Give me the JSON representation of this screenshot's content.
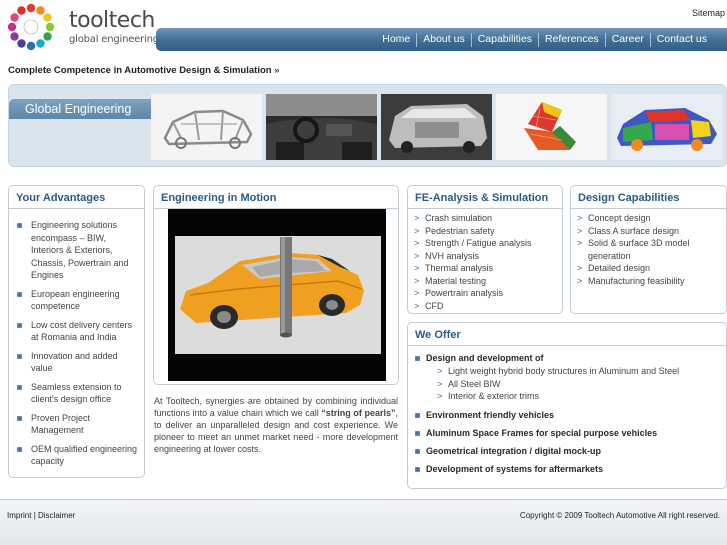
{
  "header": {
    "logo_icon": "tooltech-pearl-ring-logo",
    "brand_name": "tooltech",
    "brand_tagline": "global engineering",
    "sitemap_label": "Sitemap"
  },
  "nav": {
    "items": [
      {
        "label": "Home"
      },
      {
        "label": "About us"
      },
      {
        "label": "Capabilities"
      },
      {
        "label": "References"
      },
      {
        "label": "Career"
      },
      {
        "label": "Contact us"
      }
    ]
  },
  "tagline": {
    "text": "Complete Competence in Automotive Design & Simulation",
    "arrow": "»"
  },
  "banner": {
    "label": "Global Engineering",
    "images": [
      "body-in-white-frame",
      "car-interior-cockpit",
      "van-interior-render",
      "seat-fe-mesh",
      "car-body-fe-model"
    ]
  },
  "advantages": {
    "title": "Your Advantages",
    "items": [
      "Engineering solutions encompass – BIW, Interiors & Exteriors, Chassis, Powertrain and Engines",
      "European engineering competence",
      "Low cost delivery centers at Romania and India",
      "Innovation and added value",
      "Seamless extension to client's design office",
      "Proven Project Management",
      "OEM qualified engineering capacity"
    ]
  },
  "motion": {
    "title": "Engineering in Motion",
    "video_image": "orange-sedan-pole-crash-simulation",
    "para_before": "At Tooltech, synergies are obtained by combining individual functions into a value chain which we call ",
    "para_bold": "“string of pearls”",
    "para_after": ", to deliver an unparalleled design and cost experience. We pioneer to meet an unmet market need - more development engineering at lower costs."
  },
  "fe": {
    "title": "FE-Analysis & Simulation",
    "items": [
      "Crash simulation",
      "Pedestrian safety",
      "Strength / Fatigue analysis",
      "NVH analysis",
      "Thermal analysis",
      "Material testing",
      "Powertrain analysis",
      "CFD"
    ]
  },
  "design": {
    "title": "Design Capabilities",
    "items": [
      "Concept design",
      "Class A surface design",
      "Solid & surface 3D model generation",
      "Detailed design",
      "Manufacturing feasibility"
    ]
  },
  "offer": {
    "title": "We Offer",
    "main_label": "Design and development of",
    "sub_items": [
      "Light weight hybrid body structures in Aluminum and Steel",
      "All Steel BIW",
      "Interior & exterior trims"
    ],
    "items": [
      "Environment friendly vehicles",
      "Aluminum Space Frames for special purpose vehicles",
      "Geometrical integration / digital mock-up",
      "Development of systems for aftermarkets"
    ]
  },
  "footer": {
    "imprint": "Imprint",
    "separator": "|",
    "disclaimer": "Disclaimer",
    "copyright": "Copyright © 2009 Tooltech Automotive All right reserved."
  },
  "colors": {
    "nav_bar": "#3f6d93",
    "heading_blue": "#2a5a86",
    "banner_bg": "#d9e4ec",
    "car_orange": "#f0a020"
  }
}
